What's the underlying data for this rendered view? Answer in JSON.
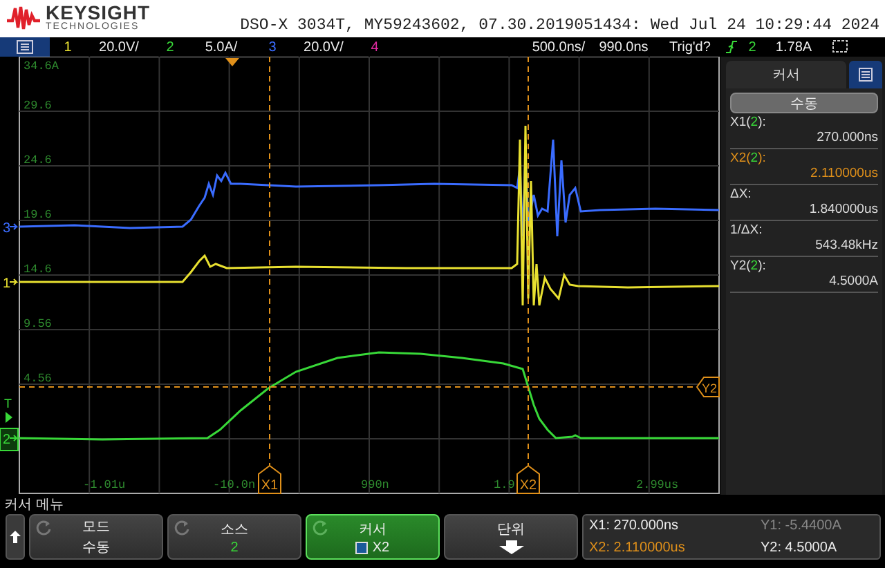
{
  "brand": {
    "name": "KEYSIGHT",
    "sub": "TECHNOLOGIES"
  },
  "title": "DSO-X 3034T, MY59243602, 07.30.2019051434: Wed Jul 24 10:29:44 2024",
  "status_bar": {
    "channels": [
      {
        "number": "1",
        "scale": "20.0V/",
        "color": "#e8e030"
      },
      {
        "number": "2",
        "scale": "5.0A/",
        "color": "#38d838"
      },
      {
        "number": "3",
        "scale": "20.0V/",
        "color": "#3a6cff"
      },
      {
        "number": "4",
        "color": "#e02aa0"
      }
    ],
    "timebase": "500.0ns/",
    "delay": "990.0ns",
    "trigger_status": "Trig'd?",
    "trigger_source": "2",
    "trigger_level": "1.78A"
  },
  "plot": {
    "y_labels": [
      "34.6A",
      "29.6",
      "24.6",
      "19.6",
      "14.6",
      "9.56",
      "4.56"
    ],
    "x_labels": [
      "-1.01u",
      "-10.0n",
      "990n",
      "1.9",
      "2.99us"
    ],
    "channel_markers": [
      {
        "number": "3",
        "color": "#3a6cff",
        "boxed": false
      },
      {
        "number": "1",
        "color": "#e8e030",
        "boxed": false
      },
      {
        "number": "2",
        "color": "#38d838",
        "boxed": true
      }
    ],
    "trigger_marker": "T",
    "cursors": [
      {
        "label": "X1"
      },
      {
        "label": "X2"
      },
      {
        "label": "Y2"
      }
    ]
  },
  "side_panel": {
    "title": "커서",
    "mode": "수동",
    "readouts": [
      {
        "prefix": "X1(",
        "source": "2",
        "suffix": "):",
        "value": "270.000ns",
        "selected": false
      },
      {
        "prefix": "X2(",
        "source": "2",
        "suffix": "):",
        "value": "2.110000us",
        "selected": true
      },
      {
        "prefix": "ΔX:",
        "value": "1.840000us",
        "selected": false
      },
      {
        "prefix": "1/ΔX:",
        "value": "543.48kHz",
        "selected": false
      },
      {
        "prefix": "Y2(",
        "source": "2",
        "suffix": "):",
        "value": "4.5000A",
        "selected": false
      }
    ]
  },
  "menu": {
    "title": "커서 메뉴",
    "softkeys": [
      {
        "kind": "knob",
        "label": "모드",
        "value": "수동",
        "selected": false
      },
      {
        "kind": "source",
        "label": "소스",
        "value": "2",
        "selected": false
      },
      {
        "kind": "cursor",
        "label": "커서",
        "value": "X2",
        "selected": true
      },
      {
        "kind": "arrow",
        "label": "단위",
        "selected": false
      }
    ],
    "readouts": [
      {
        "label": "X1:",
        "value": "270.000ns",
        "selected": false,
        "disabled": false
      },
      {
        "label": "Y1:",
        "value": "-5.4400A",
        "selected": false,
        "disabled": true
      },
      {
        "label": "X2:",
        "value": "2.110000us",
        "selected": true,
        "disabled": false
      },
      {
        "label": "Y2:",
        "value": "4.5000A",
        "selected": false,
        "disabled": false
      }
    ]
  }
}
